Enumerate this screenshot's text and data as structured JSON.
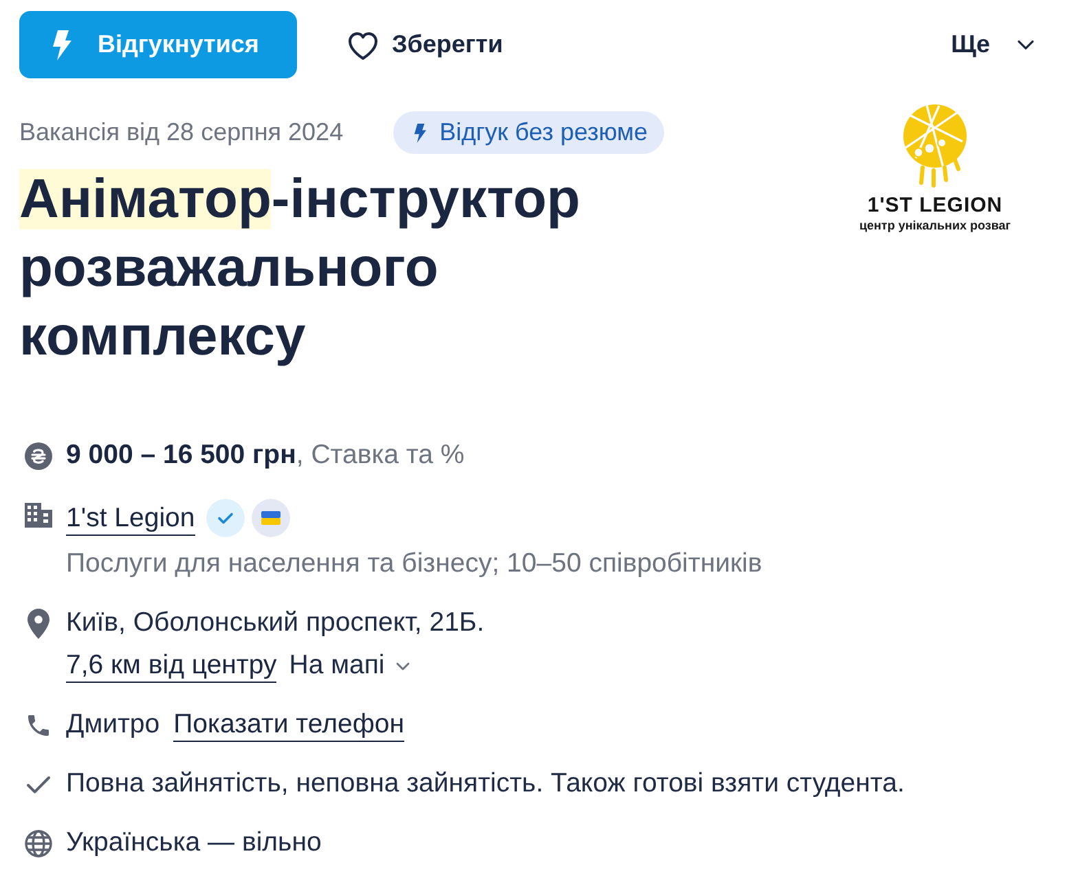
{
  "actions": {
    "apply": "Відгукнутися",
    "save": "Зберегти",
    "more": "Ще"
  },
  "posted": "Вакансія від 28 серпня 2024",
  "badge": "Відгук без резюме",
  "logo": {
    "name": "1'ST LEGION",
    "tagline": "центр унікальних розваг"
  },
  "title": [
    {
      "text": "Аніматор",
      "highlighted": true
    },
    {
      "text": "-інструктор розважального комплексу",
      "highlighted": false
    }
  ],
  "salary": "**9 000 – 16 500 грн**, Ставка та %",
  "company": {
    "name": "1'st Legion",
    "badges": [
      {
        "kind": "verified"
      },
      {
        "kind": "flag"
      }
    ],
    "details": "Послуги для населення та бізнесу; 10–50 співробітників"
  },
  "location": {
    "address": "Київ, Оболонський проспект, 21Б.",
    "distance": "7,6 км від центру",
    "map_link": "На мапі"
  },
  "contact": {
    "name": "Дмитро",
    "phone_link": "Показати телефон"
  },
  "employment": "Повна зайнятість, неповна зайнятість. Також готові взяти студента.",
  "language": "Українська — вільно"
}
